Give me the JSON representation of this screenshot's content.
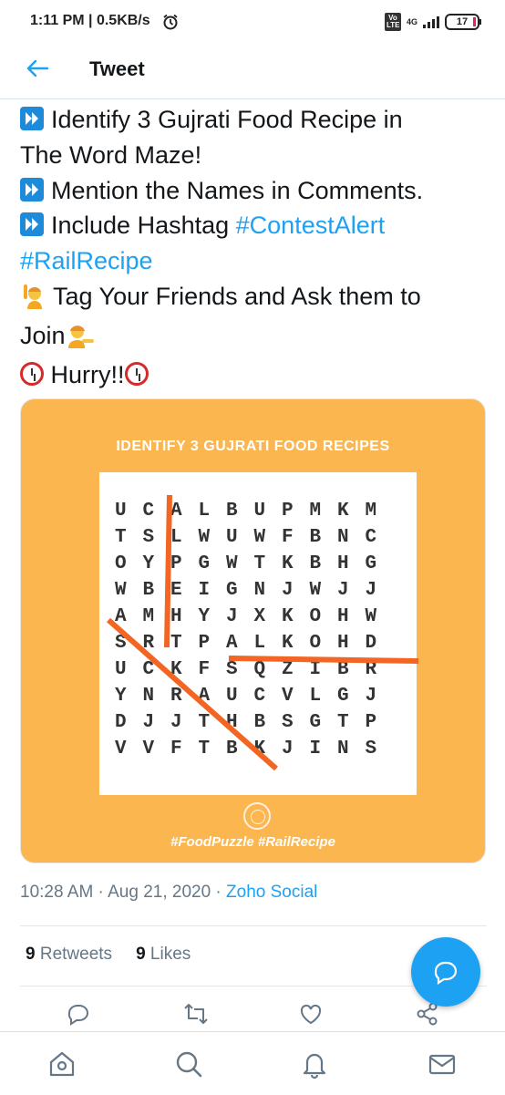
{
  "status_bar": {
    "time": "1:11 PM | 0.5KB/s",
    "alarm_icon": "alarm-icon",
    "volte": "Vo LTE",
    "network": "4G",
    "battery": "17"
  },
  "header": {
    "back_icon": "back-arrow-icon",
    "title": "Tweet"
  },
  "tweet": {
    "lines": [
      {
        "icon": "fast-forward-icon",
        "text": "Identify 3 Gujrati Food Recipe in"
      },
      {
        "text": "The Word Maze!"
      },
      {
        "icon": "fast-forward-icon",
        "text": "Mention the Names in Comments."
      },
      {
        "icon": "fast-forward-icon",
        "text": "Include Hashtag ",
        "hashtag": "#ContestAlert"
      },
      {
        "hashtag": "#RailRecipe"
      },
      {
        "icon": "raising-hand-icon",
        "text": "Tag Your Friends and Ask them to"
      },
      {
        "text": "Join",
        "icon_after": "tipping-hand-icon"
      },
      {
        "icon": "alarm-clock-icon",
        "text": "Hurry!!",
        "icon_after": "alarm-clock-icon"
      }
    ]
  },
  "card": {
    "title": "IDENTIFY 3 GUJRATI FOOD RECIPES",
    "grid": [
      [
        "U",
        "C",
        "A",
        "L",
        "B",
        "U",
        "P",
        "M",
        "K",
        "M"
      ],
      [
        "T",
        "S",
        "L",
        "W",
        "U",
        "W",
        "F",
        "B",
        "N",
        "C"
      ],
      [
        "O",
        "Y",
        "P",
        "G",
        "W",
        "T",
        "K",
        "B",
        "H",
        "G"
      ],
      [
        "W",
        "B",
        "E",
        "I",
        "G",
        "N",
        "J",
        "W",
        "J",
        "J"
      ],
      [
        "A",
        "M",
        "H",
        "Y",
        "J",
        "X",
        "K",
        "O",
        "H",
        "W"
      ],
      [
        "S",
        "R",
        "T",
        "P",
        "A",
        "L",
        "K",
        "O",
        "H",
        "D"
      ],
      [
        "U",
        "C",
        "K",
        "F",
        "S",
        "Q",
        "Z",
        "I",
        "B",
        "R"
      ],
      [
        "Y",
        "N",
        "R",
        "A",
        "U",
        "C",
        "V",
        "L",
        "G",
        "J"
      ],
      [
        "D",
        "J",
        "J",
        "T",
        "H",
        "B",
        "S",
        "G",
        "T",
        "P"
      ],
      [
        "V",
        "V",
        "F",
        "T",
        "B",
        "K",
        "J",
        "I",
        "N",
        "S"
      ]
    ],
    "highlight_color": "#f26522",
    "tags": "#FoodPuzzle #RailRecipe"
  },
  "meta": {
    "time": "10:28 AM · Aug 21, 2020 · ",
    "via": "Zoho Social"
  },
  "stats": {
    "retweets_count": "9",
    "retweets_label": "Retweets",
    "likes_count": "9",
    "likes_label": "Likes"
  },
  "actions": [
    "reply-icon",
    "retweet-icon",
    "like-icon",
    "share-icon"
  ],
  "fab": "compose-reply-icon",
  "nav": [
    "home-icon",
    "search-icon",
    "notifications-icon",
    "messages-icon"
  ],
  "colors": {
    "accent": "#1da1f2",
    "card_bg": "#fcb64f"
  }
}
